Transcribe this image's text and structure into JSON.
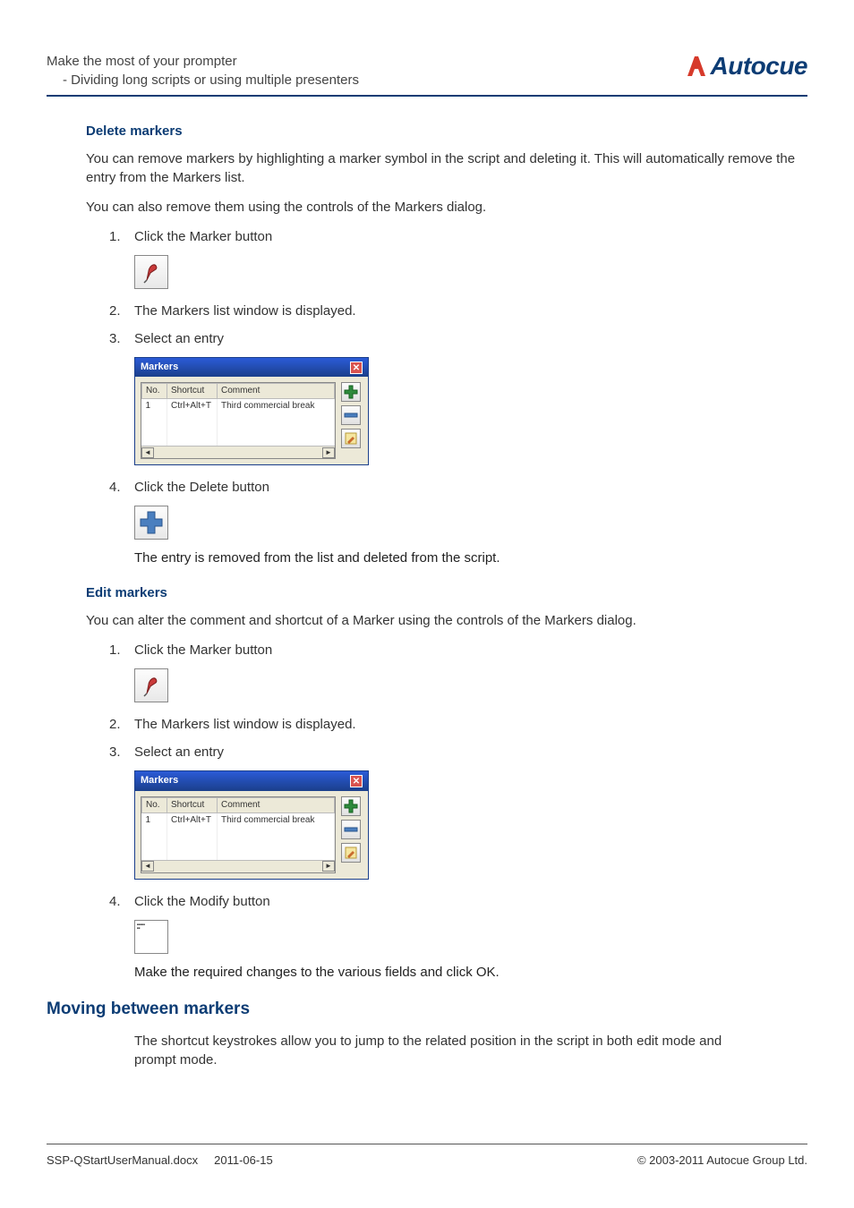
{
  "header": {
    "line1": "Make the most of your prompter",
    "line2": "- Dividing long scripts or using multiple presenters",
    "logo_text": "Autocue"
  },
  "delete_section": {
    "title": "Delete markers",
    "p1": "You can remove markers by highlighting a marker symbol in the script and deleting it. This will automatically remove the entry from the Markers list.",
    "p2": "You can also remove them using the controls of the Markers dialog.",
    "steps": [
      {
        "num": "1.",
        "text": "Click the Marker button"
      },
      {
        "num": "2.",
        "text": "The Markers list window is displayed."
      },
      {
        "num": "3.",
        "text": "Select an entry"
      },
      {
        "num": "4.",
        "text": "Click the Delete button"
      }
    ],
    "post_text": "The entry is removed from the list and deleted from the script."
  },
  "edit_section": {
    "title": "Edit markers",
    "p1": "You can alter the comment and shortcut of a Marker using the controls of the Markers dialog.",
    "steps": [
      {
        "num": "1.",
        "text": "Click the Marker button"
      },
      {
        "num": "2.",
        "text": "The Markers list window is displayed."
      },
      {
        "num": "3.",
        "text": "Select an entry"
      },
      {
        "num": "4.",
        "text": "Click the Modify button"
      }
    ],
    "post_text": "Make the required changes to the various fields and click OK."
  },
  "moving_section": {
    "title": "Moving between markers",
    "p1": "The shortcut keystrokes allow you to jump to the related position in the script in both edit mode and prompt mode."
  },
  "markers_dialog": {
    "title": "Markers",
    "columns": [
      "No.",
      "Shortcut",
      "Comment"
    ],
    "row": {
      "no": "1",
      "shortcut": "Ctrl+Alt+T",
      "comment": "Third commercial break"
    }
  },
  "footer": {
    "left1": "SSP-QStartUserManual.docx",
    "left2": "2011-06-15",
    "right": "© 2003-2011 Autocue Group Ltd."
  }
}
